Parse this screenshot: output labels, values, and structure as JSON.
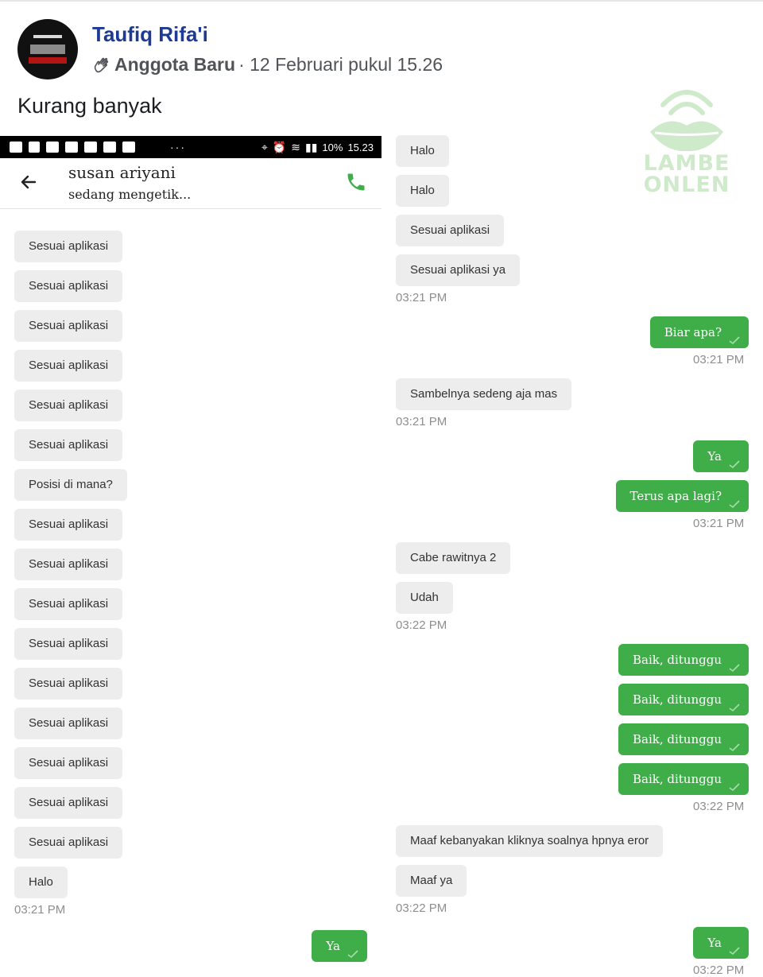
{
  "post": {
    "author": "Taufiq Rifa'i",
    "badge": "Anggota Baru",
    "date": "· 12 Februari pukul 15.26",
    "caption": "Kurang banyak"
  },
  "watermark": {
    "line1": "LAMBE",
    "line2": "ONLEN"
  },
  "statusbar": {
    "dots": "···",
    "battery": "10%",
    "time": "15.23"
  },
  "chat": {
    "contact_name": "susan ariyani",
    "contact_status": "sedang mengetik..."
  },
  "left_messages": [
    {
      "type": "in",
      "text": "Sesuai aplikasi"
    },
    {
      "type": "in",
      "text": "Sesuai aplikasi"
    },
    {
      "type": "in",
      "text": "Sesuai aplikasi"
    },
    {
      "type": "in",
      "text": "Sesuai aplikasi"
    },
    {
      "type": "in",
      "text": "Sesuai aplikasi"
    },
    {
      "type": "in",
      "text": "Sesuai aplikasi"
    },
    {
      "type": "in",
      "text": "Posisi di mana?"
    },
    {
      "type": "in",
      "text": "Sesuai aplikasi"
    },
    {
      "type": "in",
      "text": "Sesuai aplikasi"
    },
    {
      "type": "in",
      "text": "Sesuai aplikasi"
    },
    {
      "type": "in",
      "text": "Sesuai aplikasi"
    },
    {
      "type": "in",
      "text": "Sesuai aplikasi"
    },
    {
      "type": "in",
      "text": "Sesuai aplikasi"
    },
    {
      "type": "in",
      "text": "Sesuai aplikasi"
    },
    {
      "type": "in",
      "text": "Sesuai aplikasi"
    },
    {
      "type": "in",
      "text": "Sesuai aplikasi"
    },
    {
      "type": "in",
      "text": "Halo"
    },
    {
      "type": "time",
      "text": "03:21 PM"
    },
    {
      "type": "out",
      "text": "Ya"
    }
  ],
  "right_messages": [
    {
      "type": "in",
      "text": "Halo"
    },
    {
      "type": "in",
      "text": "Halo"
    },
    {
      "type": "in",
      "text": "Sesuai aplikasi"
    },
    {
      "type": "in",
      "text": "Sesuai aplikasi ya"
    },
    {
      "type": "time",
      "text": "03:21 PM"
    },
    {
      "type": "out",
      "text": "Biar apa?"
    },
    {
      "type": "time",
      "text": "03:21 PM"
    },
    {
      "type": "in",
      "text": "Sambelnya sedeng aja mas"
    },
    {
      "type": "time",
      "text": "03:21 PM"
    },
    {
      "type": "out",
      "text": "Ya"
    },
    {
      "type": "out",
      "text": "Terus apa lagi?"
    },
    {
      "type": "time",
      "text": "03:21 PM"
    },
    {
      "type": "in",
      "text": "Cabe rawitnya 2"
    },
    {
      "type": "in",
      "text": "Udah"
    },
    {
      "type": "time",
      "text": "03:22 PM"
    },
    {
      "type": "out",
      "text": "Baik, ditunggu"
    },
    {
      "type": "out",
      "text": "Baik, ditunggu"
    },
    {
      "type": "out",
      "text": "Baik, ditunggu"
    },
    {
      "type": "out",
      "text": "Baik, ditunggu"
    },
    {
      "type": "time",
      "text": "03:22 PM"
    },
    {
      "type": "in",
      "text": "Maaf kebanyakan kliknya soalnya hpnya eror"
    },
    {
      "type": "in",
      "text": "Maaf ya"
    },
    {
      "type": "time",
      "text": "03:22 PM"
    },
    {
      "type": "out",
      "text": "Ya"
    },
    {
      "type": "time",
      "text": "03:22 PM"
    }
  ],
  "colors": {
    "outgoing": "#3fae49",
    "incoming": "#ededed",
    "author": "#1f3a93"
  }
}
